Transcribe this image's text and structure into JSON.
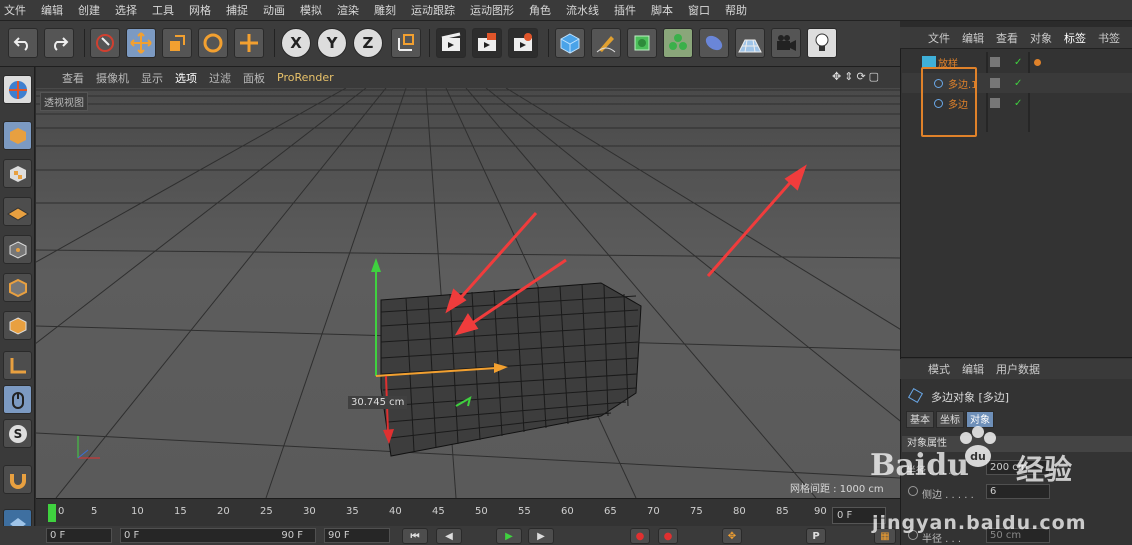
{
  "menubar": [
    "文件",
    "编辑",
    "创建",
    "选择",
    "工具",
    "网格",
    "捕捉",
    "动画",
    "模拟",
    "渲染",
    "雕刻",
    "运动跟踪",
    "运动图形",
    "角色",
    "流水线",
    "插件",
    "脚本",
    "窗口",
    "帮助"
  ],
  "toolbar": {
    "x_label": "X",
    "y_label": "Y",
    "z_label": "Z"
  },
  "viewport_menu": [
    "查看",
    "摄像机",
    "显示",
    "选项",
    "过滤",
    "面板",
    "ProRender"
  ],
  "viewport": {
    "label": "透视视图",
    "grid_spacing": "网格间距 : 1000 cm",
    "measure": "30.745 cm"
  },
  "timeline": {
    "ticks": [
      "0",
      "5",
      "10",
      "15",
      "20",
      "25",
      "30",
      "35",
      "40",
      "45",
      "50",
      "55",
      "60",
      "65",
      "70",
      "75",
      "80",
      "85",
      "90"
    ],
    "current_frame": "0 F",
    "start_field": "0 F",
    "min_field": "0 F",
    "max_field": "90 F",
    "end_field": "90 F"
  },
  "object_manager": {
    "menu": [
      "文件",
      "编辑",
      "查看",
      "对象",
      "标签",
      "书签"
    ],
    "items": [
      {
        "name": "放样",
        "color": "#e0822a"
      },
      {
        "name": "多边.1",
        "color": "#e0822a"
      },
      {
        "name": "多边",
        "color": "#e0822a"
      }
    ]
  },
  "attributes": {
    "menu": [
      "模式",
      "编辑",
      "用户数据"
    ],
    "object_title": "多边对象 [多边]",
    "tabs": [
      "基本",
      "坐标",
      "对象"
    ],
    "section": "对象属性",
    "rows": [
      {
        "label": "半径 . . . . .",
        "value": "200 cm"
      },
      {
        "label": "侧边 . . . . .",
        "value": "6"
      },
      {
        "label": "半径 . . .",
        "value": "50 cm"
      }
    ]
  },
  "watermark": {
    "brand": "Baidu",
    "brand2": "经验",
    "domain": "jingyan.baidu.com"
  }
}
